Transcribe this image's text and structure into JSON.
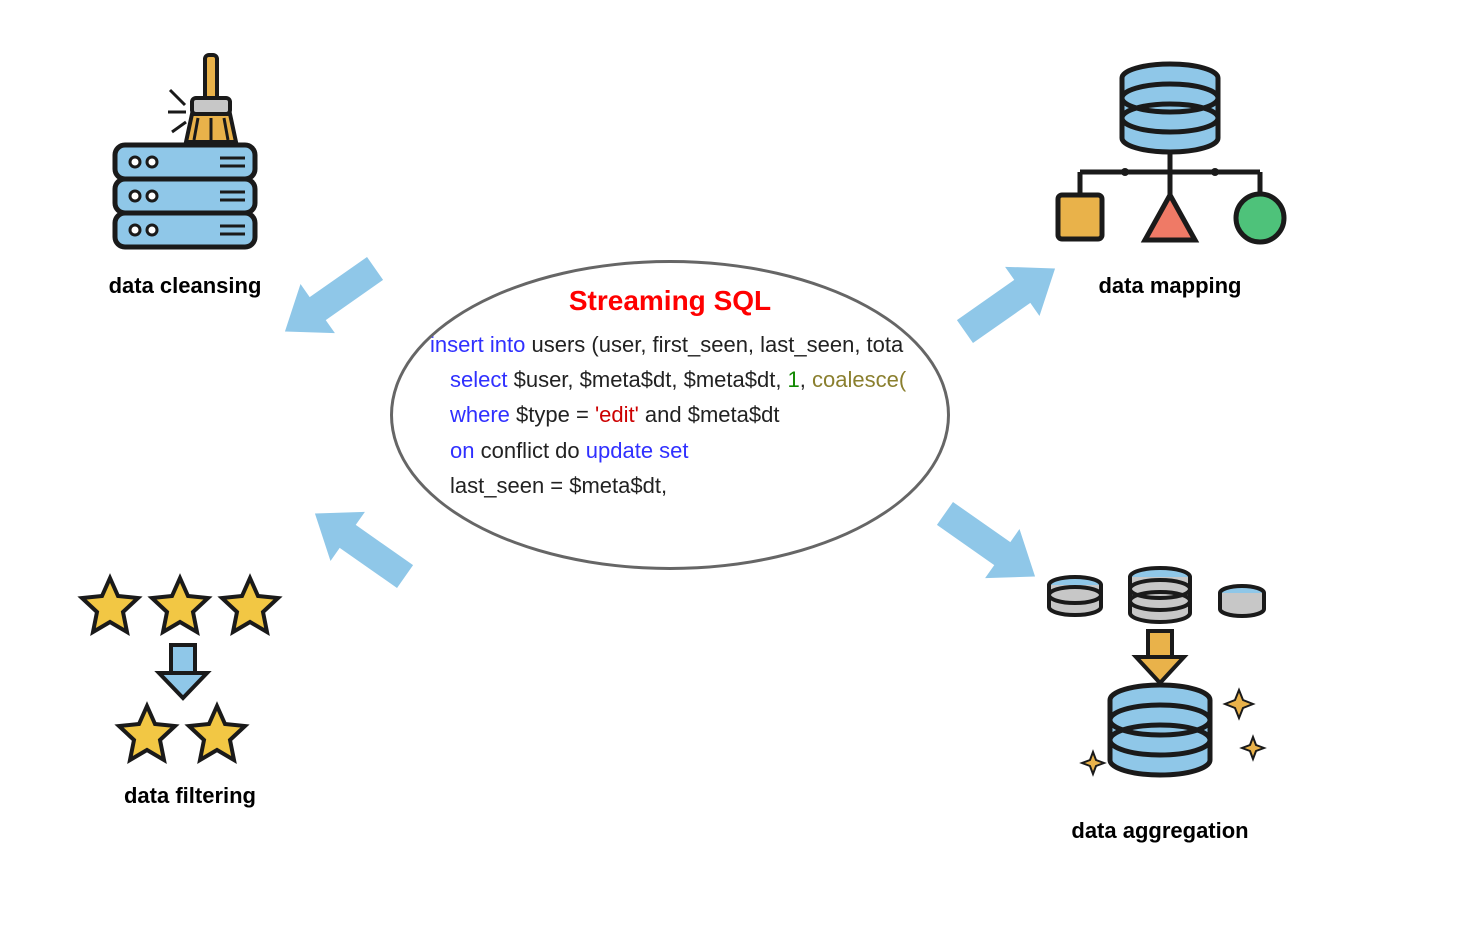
{
  "center": {
    "title": "Streaming SQL",
    "lines": {
      "l1a": "insert into",
      "l1b": " users (user, first_seen, last_seen, tota",
      "l2a": "select",
      "l2b": " $user, $meta$dt, $meta$dt, ",
      "l2c": "1",
      "l2d": ", ",
      "l2e": "coalesce(",
      "l3a": "where",
      "l3b": " $type = ",
      "l3c": "'edit'",
      "l3d": " and $meta$dt",
      "l4a": "on",
      "l4b": " conflict do ",
      "l4c": "update set",
      "l5": " last_seen = $meta$dt,"
    }
  },
  "labels": {
    "cleansing": "data cleansing",
    "mapping": "data mapping",
    "filtering": "data filtering",
    "aggregation": "data aggregation"
  }
}
